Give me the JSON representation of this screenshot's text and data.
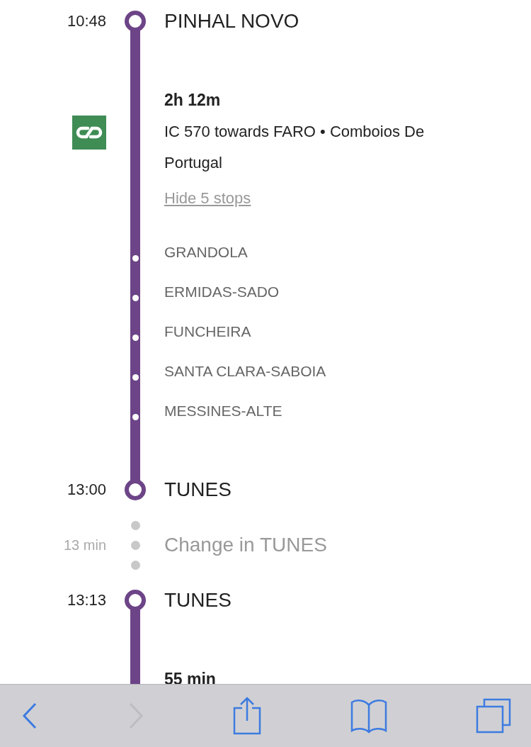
{
  "segments": [
    {
      "kind": "stop",
      "time": "10:48",
      "name": "PINHAL NOVO"
    },
    {
      "kind": "leg",
      "duration": "2h 12m",
      "route": "IC 570 towards FARO • Comboios De Portugal",
      "toggle": "Hide 5 stops",
      "stops": [
        "GRANDOLA",
        "ERMIDAS-SADO",
        "FUNCHEIRA",
        "SANTA CLARA-SABOIA",
        "MESSINES-ALTE"
      ]
    },
    {
      "kind": "stop",
      "time": "13:00",
      "name": "TUNES"
    },
    {
      "kind": "transfer",
      "time": "13 min",
      "text": "Change in TUNES"
    },
    {
      "kind": "stop",
      "time": "13:13",
      "name": "TUNES"
    },
    {
      "kind": "leg",
      "duration": "55 min"
    }
  ],
  "toolbar": [
    {
      "kind": "back",
      "disabled": false
    },
    {
      "kind": "forward",
      "disabled": true
    },
    {
      "kind": "share",
      "disabled": false
    },
    {
      "kind": "bookmarks",
      "disabled": false
    },
    {
      "kind": "tabs",
      "disabled": false
    }
  ]
}
